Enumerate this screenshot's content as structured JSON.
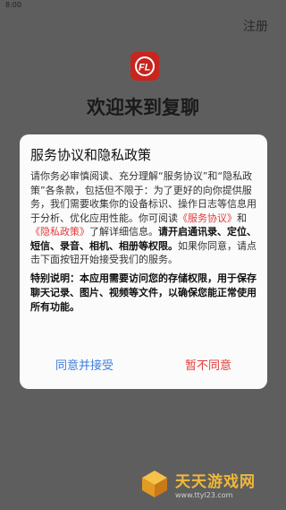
{
  "status": {
    "time": "8:00"
  },
  "header": {
    "register_label": "注册"
  },
  "welcome": {
    "title": "欢迎来到复聊"
  },
  "dialog": {
    "title": "服务协议和隐私政策",
    "p1_a": "请你务必审慎阅读、充分理解“服务协议”和“隐私政策”各条款，包括但不限于：为了更好的向你提供服务，我们需要收集你的设备标识、操作日志等信息用于分析、优化应用性能。你可阅读",
    "link_service": "《服务协议》",
    "and": "和",
    "link_privacy": "《隐私政策》",
    "p1_b": "了解详细信息。",
    "p1_bold": "请开启通讯录、定位、短信、录音、相机、相册等权限。",
    "p1_c": "如果你同意，请点击下面按钮开始接受我们的服务。",
    "notice": "特别说明：本应用需要访问您的存储权限，用于保存聊天记录、图片、视频等文件，以确保您能正常使用所有功能。",
    "accept_label": "同意并接受",
    "decline_label": "暂不同意"
  },
  "watermark": {
    "title": "天天游戏网",
    "url": "www.ttyl23.com"
  },
  "colors": {
    "accent": "#3c7fe0",
    "danger": "#e53b3b",
    "brand": "#c8251f",
    "watermark": "#f0b93a"
  }
}
